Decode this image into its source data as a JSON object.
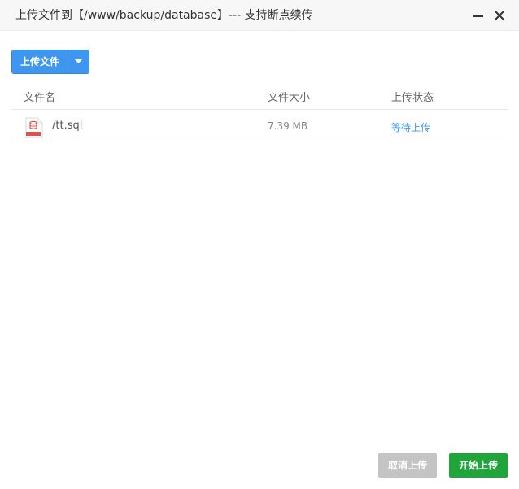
{
  "dialog": {
    "title": "上传文件到【/www/backup/database】--- 支持断点续传"
  },
  "toolbar": {
    "upload_label": "上传文件"
  },
  "table": {
    "headers": {
      "name": "文件名",
      "size": "文件大小",
      "status": "上传状态"
    },
    "rows": [
      {
        "name": "/tt.sql",
        "size": "7.39 MB",
        "status": "等待上传"
      }
    ]
  },
  "footer": {
    "cancel_label": "取消上传",
    "start_label": "开始上传"
  },
  "icons": {
    "minimize": "minimize-icon",
    "close": "close-icon",
    "dropdown": "caret-down-icon",
    "file": "sql-file-icon"
  },
  "colors": {
    "primary": "#3f96ee",
    "success": "#20a53a",
    "disabled": "#c4c4c4"
  }
}
